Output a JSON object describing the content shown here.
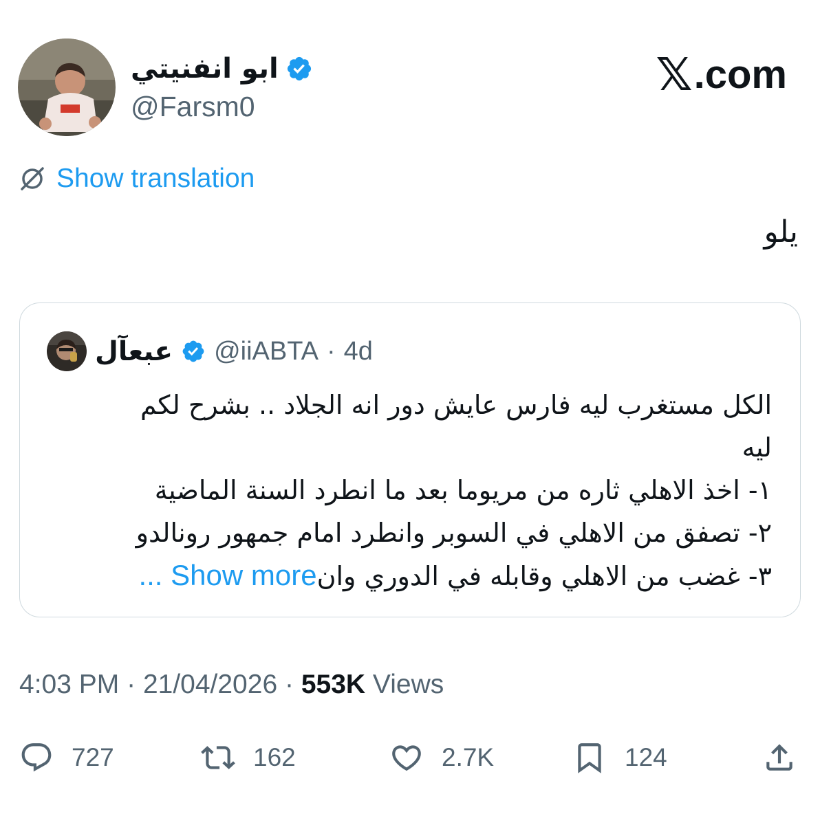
{
  "brand": {
    "logo_letter": "𝕏",
    "domain": ".com"
  },
  "author": {
    "display_name": "ابو انفنيتي",
    "handle": "@Farsm0",
    "verified": true
  },
  "translation": {
    "label": "Show translation"
  },
  "tweet": {
    "text": "يلو"
  },
  "quote": {
    "author_name": "عبعآل",
    "handle": "@iiABTA",
    "separator": "·",
    "age": "4d",
    "lines": [
      "الكل مستغرب ليه فارس عايش دور انه الجلاد .. بشرح لكم",
      "ليه",
      "١- اخذ الاهلي ثاره من مريوما بعد ما انطرد السنة الماضية",
      "٢- تصفق من الاهلي في السوبر وانطرد امام جمهور رونالدو"
    ],
    "last_line": "٣- غضب من الاهلي وقابله في الدوري وان",
    "show_more": "... Show more"
  },
  "meta": {
    "time": "4:03 PM",
    "date": "21/04/2026",
    "separator": "·",
    "views_count": "553K",
    "views_label": "Views"
  },
  "actions": {
    "replies": "727",
    "reposts": "162",
    "likes": "2.7K",
    "bookmarks": "124"
  },
  "colors": {
    "accent": "#1d9bf0",
    "muted": "#536471",
    "text": "#0f1419",
    "border": "#cfd9de"
  }
}
